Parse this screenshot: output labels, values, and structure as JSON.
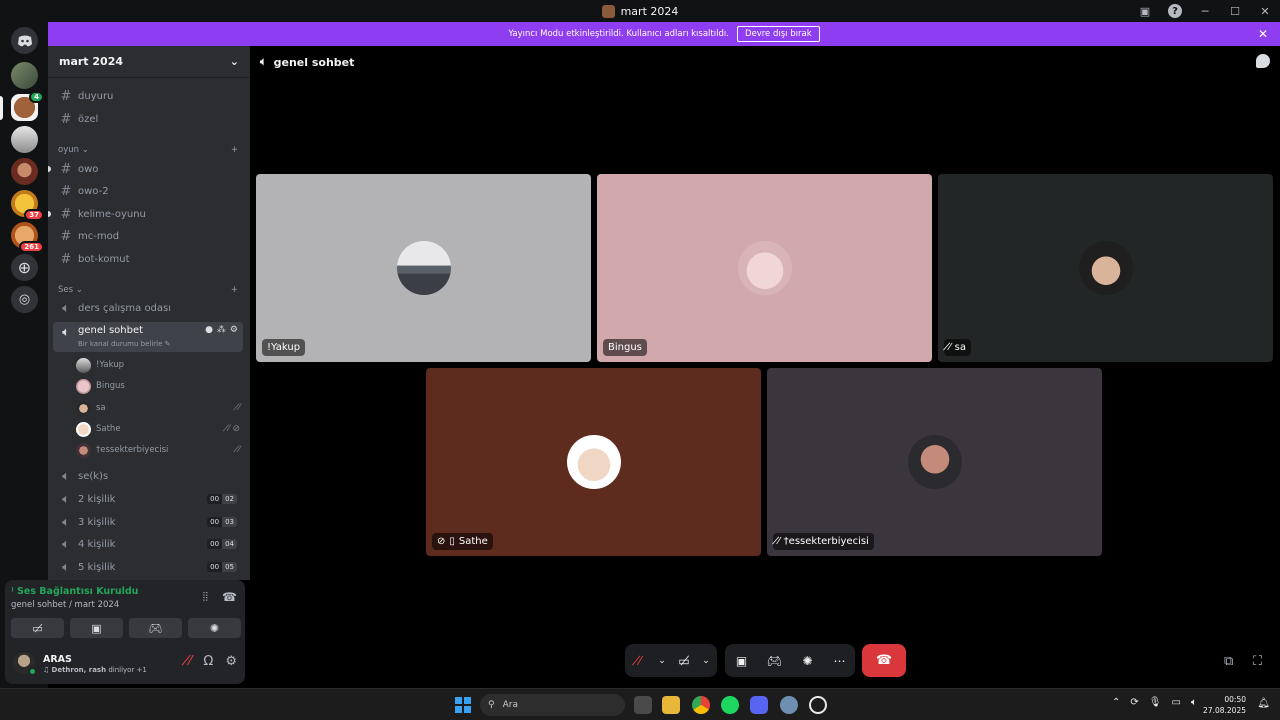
{
  "window": {
    "title": "mart 2024"
  },
  "banner": {
    "text": "Yayıncı Modu etkinleştirildi. Kullanıcı adları kısaltıldı.",
    "button": "Devre dışı bırak"
  },
  "guilds": {
    "badges": [
      "4",
      "37",
      "261"
    ]
  },
  "server": {
    "name": "mart 2024",
    "text_channels_top": [
      "duyuru",
      "özel"
    ],
    "category_oyun": "oyun",
    "oyun_channels": [
      "owo",
      "owo-2",
      "kelime-oyunu",
      "mc-mod",
      "bot-komut"
    ],
    "category_ses": "Ses",
    "voice_channels_before": [
      "ders çalışma odası"
    ],
    "active_channel": {
      "name": "genel sohbet",
      "status": "Bir kanal durumu belirle"
    },
    "members": [
      "!Yakup",
      "Bingus",
      "sa",
      "Sathe",
      "†essekterbiyecisi"
    ],
    "voice_channels_after": [
      {
        "name": "se(k)s"
      },
      {
        "name": "2 kişilik",
        "count": "00",
        "limit": "02"
      },
      {
        "name": "3 kişilik",
        "count": "00",
        "limit": "03"
      },
      {
        "name": "4 kişilik",
        "count": "00",
        "limit": "04"
      },
      {
        "name": "5 kişilik",
        "count": "00",
        "limit": "05"
      }
    ]
  },
  "voice": {
    "status": "Ses Bağlantısı Kuruldu",
    "location": "genel sohbet / mart 2024"
  },
  "user": {
    "name": "ARAS",
    "activity_names": "Dethron, rash",
    "activity_rest": "dinliyor +1"
  },
  "main": {
    "channel_title": "genel sohbet",
    "tiles": [
      {
        "name": "!Yakup",
        "bg": "#b3b3b6"
      },
      {
        "name": "Bingus",
        "bg": "#d1a9ad"
      },
      {
        "name": "sa",
        "bg": "#222626"
      },
      {
        "name": "Sathe",
        "bg": "#5e2b1f"
      },
      {
        "name": "†essekterbiyecisi",
        "bg": "#3b353d"
      }
    ]
  },
  "taskbar": {
    "search_placeholder": "Ara",
    "time": "00:50",
    "date": "27.08.2025"
  },
  "colors": {
    "accent_banner": "#8e3df0",
    "hangup": "#da373c",
    "connected_green": "#23a55a"
  }
}
